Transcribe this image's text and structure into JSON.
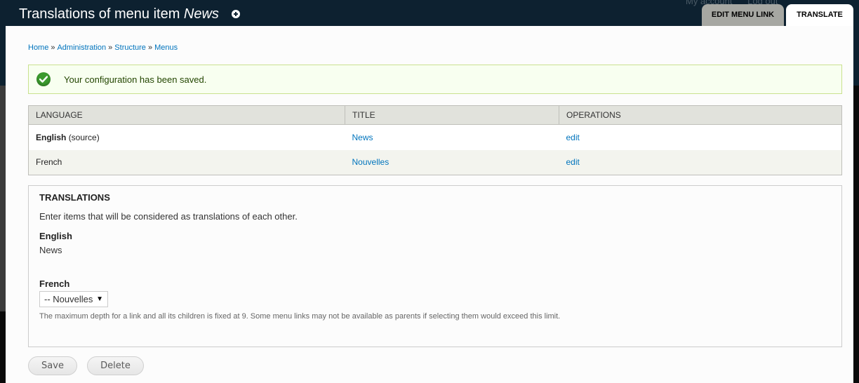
{
  "header": {
    "title_prefix": "Translations of menu item ",
    "title_item": "News",
    "shortcut_icon": "add-shortcut-icon",
    "secondary_links": [
      "My account",
      "Log out"
    ],
    "tabs": [
      {
        "label": "Edit menu link",
        "active": false
      },
      {
        "label": "Translate",
        "active": true
      }
    ]
  },
  "breadcrumb": {
    "items": [
      "Home",
      "Administration",
      "Structure",
      "Menus"
    ],
    "separator": "»"
  },
  "message": {
    "icon": "check-circle-icon",
    "text": "Your configuration has been saved.",
    "type": "status"
  },
  "table": {
    "headers": [
      "Language",
      "Title",
      "Operations"
    ],
    "rows": [
      {
        "language": "English",
        "language_note": "(source)",
        "title": "News",
        "operation": "edit"
      },
      {
        "language": "French",
        "language_note": "",
        "title": "Nouvelles",
        "operation": "edit"
      }
    ]
  },
  "translations_fieldset": {
    "legend": "Translations",
    "description": "Enter items that will be considered as translations of each other.",
    "english_label": "English",
    "english_value": "News",
    "french_label": "French",
    "french_selected": "-- Nouvelles",
    "help_text": "The maximum depth for a link and all its children is fixed at 9. Some menu links may not be available as parents if selecting them would exceed this limit."
  },
  "actions": {
    "save_label": "Save",
    "delete_label": "Delete"
  },
  "colors": {
    "header_bg": "#0d2130",
    "link": "#0074bd",
    "status_bg": "#f8fff0",
    "status_border": "#c9e18f",
    "status_icon": "#3b9a2e"
  }
}
